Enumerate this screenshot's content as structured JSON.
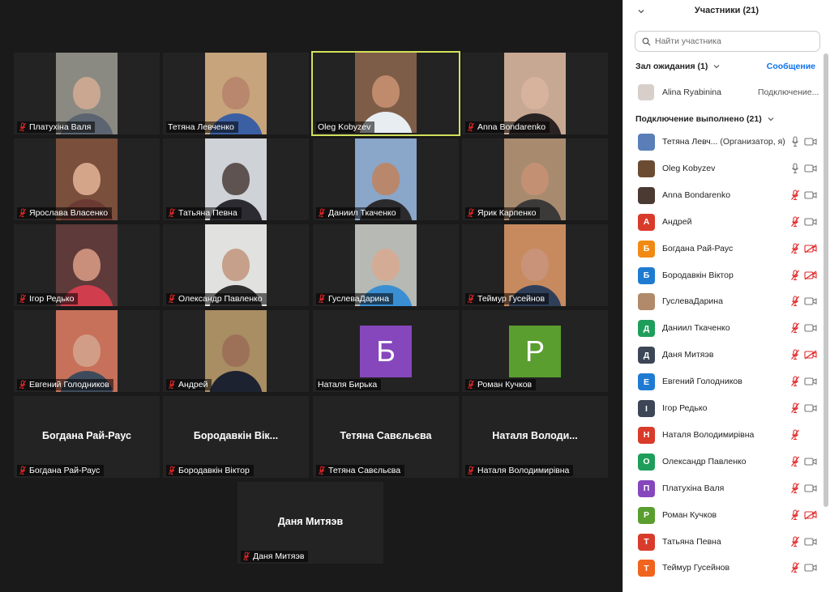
{
  "colors": {
    "mute_red": "#e02828",
    "active_border": "#d3e05a",
    "link_blue": "#0e72ed"
  },
  "gallery": {
    "tiles": [
      {
        "name": "Платухіна Валя",
        "type": "video",
        "bg": "#8b8a82",
        "skin": "#c9a791",
        "shirt": "#5b6470",
        "muted": true
      },
      {
        "name": "Тетяна Левченко",
        "type": "video",
        "bg": "#c7a47b",
        "skin": "#b8876e",
        "shirt": "#3b5fa3",
        "muted": false
      },
      {
        "name": "Oleg Kobyzev",
        "type": "video",
        "bg": "#7e5d48",
        "skin": "#c08a6c",
        "shirt": "#e8edf2",
        "muted": false,
        "active": true
      },
      {
        "name": "Anna Bondarenko",
        "type": "video",
        "bg": "#c7a893",
        "skin": "#d7b39e",
        "shirt": "#2a2323",
        "muted": true
      },
      {
        "name": "Ярослава Власенко",
        "type": "video",
        "bg": "#7a4f3c",
        "skin": "#d5a58a",
        "shirt": "#6a3a33",
        "muted": true
      },
      {
        "name": "Татьяна Певна",
        "type": "video",
        "bg": "#cfd2d6",
        "skin": "#5e5351",
        "shirt": "#2b2b31",
        "muted": true
      },
      {
        "name": "Даниил Ткаченко",
        "type": "video",
        "bg": "#8aa6c9",
        "skin": "#b9876b",
        "shirt": "#2b2b2d",
        "muted": true
      },
      {
        "name": "Ярик Карпенко",
        "type": "video",
        "bg": "#a88b6f",
        "skin": "#c39074",
        "shirt": "#3b3a39",
        "muted": true
      },
      {
        "name": "Ігор Редько",
        "type": "video",
        "bg": "#5e3a3a",
        "skin": "#c98f7a",
        "shirt": "#d03d4c",
        "muted": true
      },
      {
        "name": "Олександр Павленко",
        "type": "video",
        "bg": "#e1e1df",
        "skin": "#c6a08a",
        "shirt": "#2f2f2f",
        "muted": true
      },
      {
        "name": "ГуслеваДарина",
        "type": "video",
        "bg": "#b6b9b4",
        "skin": "#d4ac96",
        "shirt": "#3a8fd2",
        "muted": true
      },
      {
        "name": "Теймур Гусейнов",
        "type": "video",
        "bg": "#c78a5e",
        "skin": "#c99379",
        "shirt": "#2f3f5a",
        "muted": true
      },
      {
        "name": "Евгений Голодников",
        "type": "video",
        "bg": "#c7715a",
        "skin": "#d29d86",
        "shirt": "#3e4b5c",
        "muted": true
      },
      {
        "name": "Андрей",
        "type": "video",
        "bg": "#a98d63",
        "skin": "#9c7158",
        "shirt": "#1d2230",
        "muted": true
      },
      {
        "name": "Наталя Бирька",
        "type": "avatar",
        "letter": "Б",
        "color": "#8647bd",
        "muted": false
      },
      {
        "name": "Роман Кучков",
        "type": "avatar",
        "letter": "Р",
        "color": "#5a9e2f",
        "muted": true
      },
      {
        "name": "Богдана Рай-Раус",
        "type": "name",
        "big": "Богдана Рай-Раус",
        "muted": true
      },
      {
        "name": "Бородавкін Віктор",
        "type": "name",
        "big": "Бородавкін Вік...",
        "muted": true
      },
      {
        "name": "Тетяна Савєльєва",
        "type": "name",
        "big": "Тетяна Савєльєва",
        "muted": true
      },
      {
        "name": "Наталя Володимирівна",
        "type": "name",
        "big": "Наталя  Володи...",
        "muted": true
      },
      {
        "name": "Даня Митяэв",
        "type": "name",
        "big": "Даня Митяэв",
        "muted": true
      }
    ]
  },
  "panel": {
    "title": "Участники (21)",
    "collapse_icon": "chevron-down-icon",
    "search_placeholder": "Найти участника",
    "waiting_room": {
      "label": "Зал ожидания (1)",
      "message_button": "Сообщение",
      "person": {
        "name": "Alina Ryabinina",
        "status": "Подключение..."
      }
    },
    "connected": {
      "label": "Подключение выполнено (21)",
      "people": [
        {
          "name": "Тетяна Левч...",
          "role": "(Организатор, я)",
          "avatar": "photo",
          "color": "#5a7fb8",
          "mic": "on",
          "cam": "on"
        },
        {
          "name": "Oleg Kobyzev",
          "avatar": "photo",
          "color": "#6b4c33",
          "mic": "on",
          "cam": "on"
        },
        {
          "name": "Anna Bondarenko",
          "avatar": "photo",
          "color": "#4a3a32",
          "mic": "off",
          "cam": "on"
        },
        {
          "name": "Андрей",
          "letter": "А",
          "color": "#d93b2b",
          "mic": "off",
          "cam": "on"
        },
        {
          "name": "Богдана Рай-Раус",
          "letter": "Б",
          "color": "#f08a14",
          "mic": "off",
          "cam": "off"
        },
        {
          "name": "Бородавкін Віктор",
          "letter": "Б",
          "color": "#1f7bd1",
          "mic": "off",
          "cam": "off"
        },
        {
          "name": "ГуслеваДарина",
          "avatar": "photo",
          "color": "#b08a6a",
          "mic": "off",
          "cam": "on"
        },
        {
          "name": "Даниил Ткаченко",
          "letter": "Д",
          "color": "#1f9e5b",
          "mic": "off",
          "cam": "on"
        },
        {
          "name": "Даня Митяэв",
          "letter": "Д",
          "color": "#3d4656",
          "mic": "off",
          "cam": "off"
        },
        {
          "name": "Евгений Голодников",
          "letter": "Е",
          "color": "#1f7bd1",
          "mic": "off",
          "cam": "on"
        },
        {
          "name": "Ігор Редько",
          "letter": "І",
          "color": "#3d4656",
          "mic": "off",
          "cam": "on"
        },
        {
          "name": "Наталя Володимирівна",
          "letter": "Н",
          "color": "#d93b2b",
          "mic": "off",
          "cam": "none"
        },
        {
          "name": "Олександр Павленко",
          "letter": "О",
          "color": "#1f9e5b",
          "mic": "off",
          "cam": "on"
        },
        {
          "name": "Платухіна Валя",
          "letter": "П",
          "color": "#8647bd",
          "mic": "off",
          "cam": "on"
        },
        {
          "name": "Роман Кучков",
          "letter": "Р",
          "color": "#5a9e2f",
          "mic": "off",
          "cam": "off"
        },
        {
          "name": "Татьяна Певна",
          "letter": "Т",
          "color": "#d93b2b",
          "mic": "off",
          "cam": "on"
        },
        {
          "name": "Теймур Гусейнов",
          "letter": "Т",
          "color": "#f0641e",
          "mic": "off",
          "cam": "on"
        }
      ]
    }
  }
}
